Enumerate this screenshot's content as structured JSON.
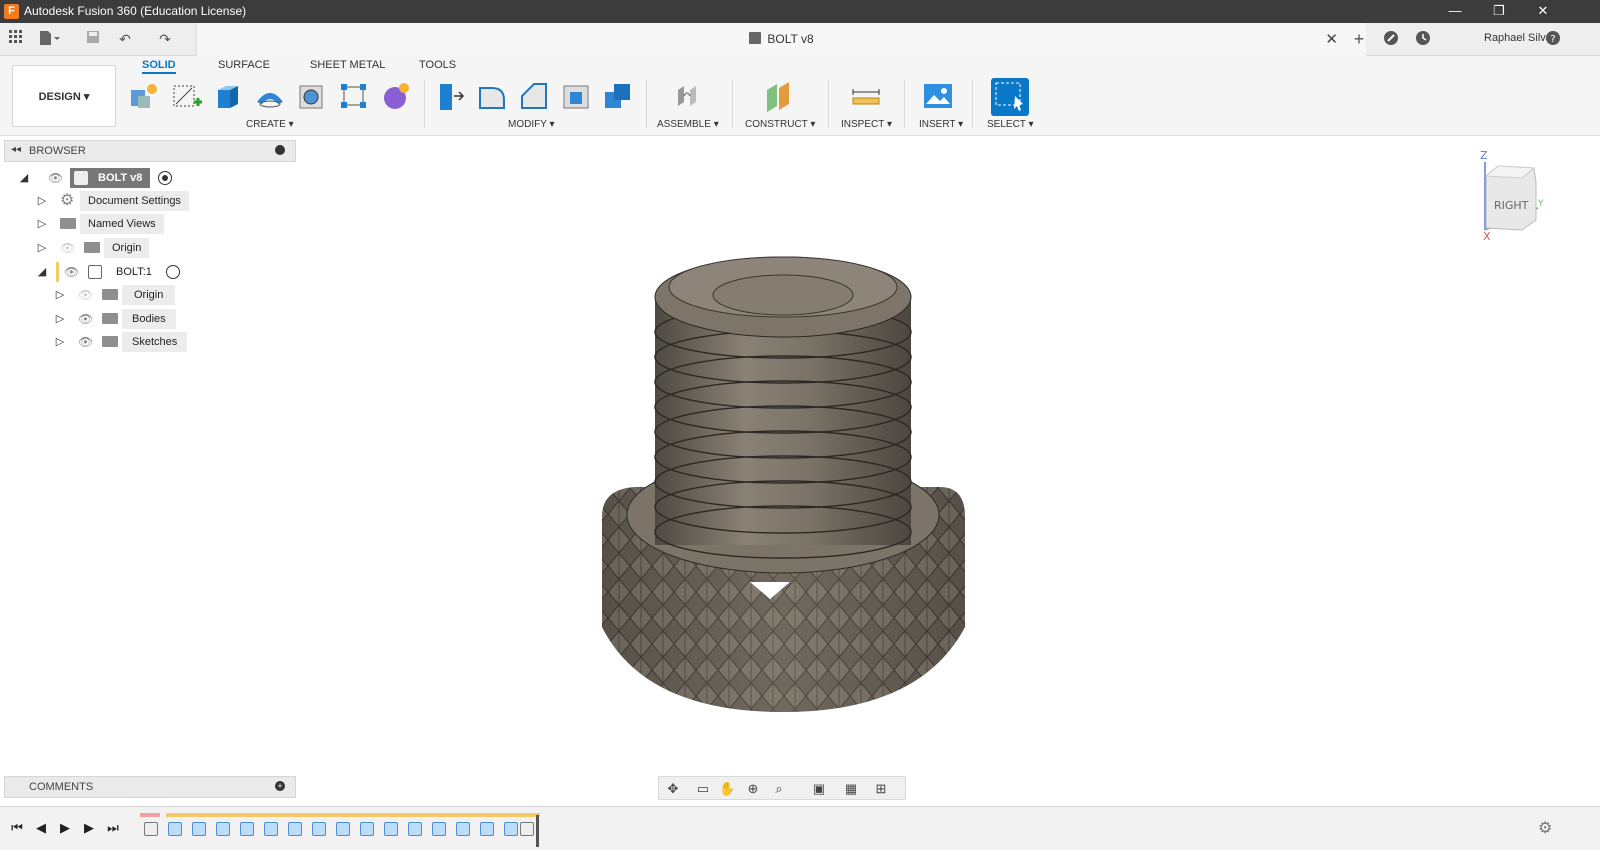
{
  "window": {
    "title": "Autodesk Fusion 360 (Education License)",
    "controls": {
      "minimize": "—",
      "restore": "❐",
      "close": "✕"
    }
  },
  "quickbar": {
    "document_title": "BOLT v8",
    "close_tab": "✕",
    "user": "Raphael Silva"
  },
  "ribbon": {
    "workspace": "DESIGN ▾",
    "tabs": [
      "SOLID",
      "SURFACE",
      "SHEET METAL",
      "TOOLS"
    ],
    "active_tab": "SOLID",
    "groups": [
      "CREATE ▾",
      "MODIFY ▾",
      "ASSEMBLE ▾",
      "CONSTRUCT ▾",
      "INSPECT ▾",
      "INSERT ▾",
      "SELECT ▾"
    ]
  },
  "browser": {
    "title": "BROWSER",
    "items": [
      {
        "label": "BOLT v8"
      },
      {
        "label": "Document Settings"
      },
      {
        "label": "Named Views"
      },
      {
        "label": "Origin"
      },
      {
        "label": "BOLT:1"
      },
      {
        "label": "Origin"
      },
      {
        "label": "Bodies"
      },
      {
        "label": "Sketches"
      }
    ]
  },
  "comments": {
    "title": "COMMENTS"
  },
  "viewcube": {
    "face": "RIGHT",
    "axis_z": "Z",
    "axis_y": "Y",
    "axis_x": "X"
  },
  "colors": {
    "accent": "#0a78c8",
    "titlebar": "#3c3c3c",
    "bolt_metal": "#7d7468",
    "timeline_bar": "#f6c86a"
  }
}
